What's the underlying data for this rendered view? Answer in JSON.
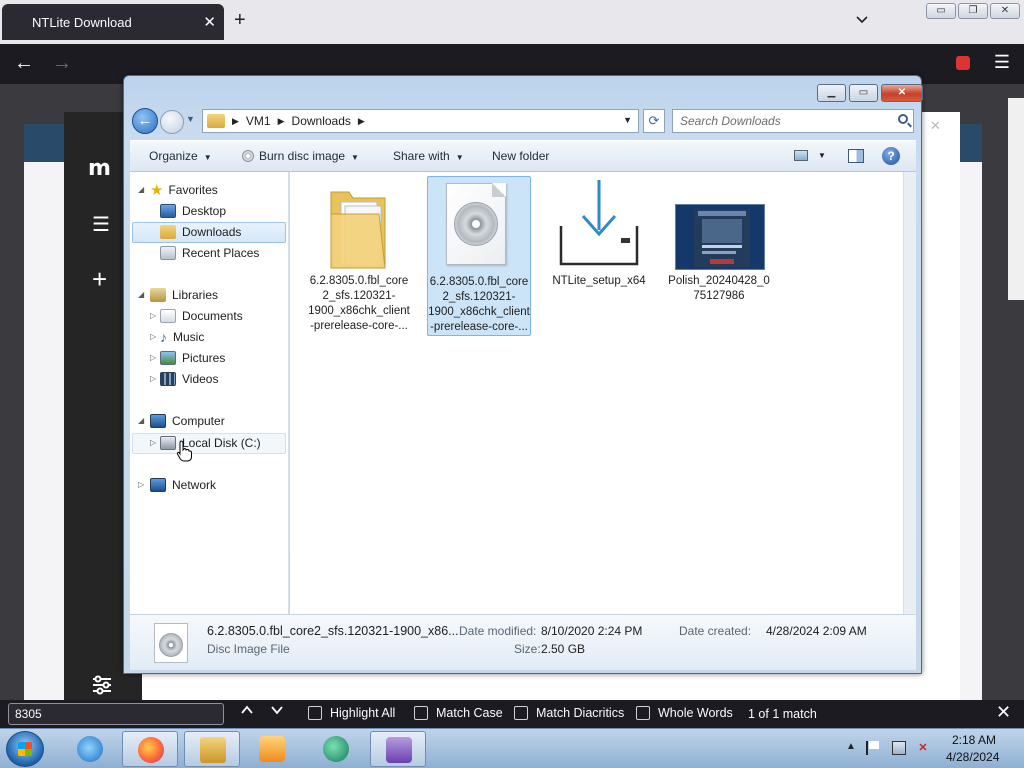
{
  "browser": {
    "tab_title": "NTLite Download",
    "tab_close": "✕",
    "new_tab": "+",
    "tab_list": "⌄",
    "window_controls": {
      "minimize": "▭",
      "restore": "❐",
      "close": "✕"
    }
  },
  "ntlite": {
    "logo": "m",
    "window_controls": {
      "minimize": "—",
      "maximize": "⬚",
      "close": "✕"
    }
  },
  "explorer": {
    "breadcrumb": [
      "VM1",
      "Downloads"
    ],
    "search_placeholder": "Search Downloads",
    "commands": {
      "organize": "Organize",
      "burn": "Burn disc image",
      "share": "Share with",
      "new_folder": "New folder"
    },
    "nav": {
      "favorites": "Favorites",
      "desktop": "Desktop",
      "downloads": "Downloads",
      "recent": "Recent Places",
      "libraries": "Libraries",
      "documents": "Documents",
      "music": "Music",
      "pictures": "Pictures",
      "videos": "Videos",
      "computer": "Computer",
      "local_disk": "Local Disk (C:)",
      "network": "Network"
    },
    "files": [
      {
        "name": "6.2.8305.0.fbl_core2_sfs.120321-1900_x86chk_client-prerelease-core-...",
        "icon": "folder-icon"
      },
      {
        "name": "6.2.8305.0.fbl_core2_sfs.120321-1900_x86chk_client-prerelease-core-...",
        "icon": "disc-image-icon"
      },
      {
        "name": "NTLite_setup_x64",
        "icon": "download-installer-icon"
      },
      {
        "name": "Polish_20240428_075127986",
        "icon": "image-thumbnail"
      }
    ],
    "details": {
      "filename": "6.2.8305.0.fbl_core2_sfs.120321-1900_x86...",
      "type": "Disc Image File",
      "modified_label": "Date modified:",
      "modified_value": "8/10/2020 2:24 PM",
      "size_label": "Size:",
      "size_value": "2.50 GB",
      "created_label": "Date created:",
      "created_value": "4/28/2024 2:09 AM"
    },
    "colors": {
      "selection": "#cce4f7",
      "selection_border": "#7eb4ea",
      "download_arrow": "#2e8bc9"
    }
  },
  "find_bar": {
    "query": "8305",
    "options": [
      "Highlight All",
      "Match Case",
      "Match Diacritics",
      "Whole Words"
    ],
    "status": "1 of 1 match"
  },
  "taskbar": {
    "apps": [
      "internet-explorer-icon",
      "firefox-icon",
      "file-explorer-icon",
      "media-player-icon",
      "ntlite-icon",
      "app-icon"
    ],
    "time": "2:18 AM",
    "date": "4/28/2024"
  }
}
